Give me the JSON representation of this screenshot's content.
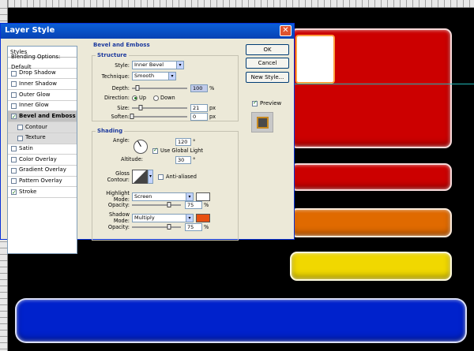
{
  "dialog": {
    "title": "Layer Style",
    "close_glyph": "✕",
    "styles_list": {
      "header": "Styles",
      "items": [
        {
          "label": "Blending Options: Default",
          "checkbox": false,
          "checked": false
        },
        {
          "label": "Drop Shadow",
          "checkbox": true,
          "checked": false
        },
        {
          "label": "Inner Shadow",
          "checkbox": true,
          "checked": false
        },
        {
          "label": "Outer Glow",
          "checkbox": true,
          "checked": false
        },
        {
          "label": "Inner Glow",
          "checkbox": true,
          "checked": false
        },
        {
          "label": "Bevel and Emboss",
          "checkbox": true,
          "checked": true,
          "selected": true
        },
        {
          "label": "Contour",
          "checkbox": true,
          "checked": false,
          "sub": true
        },
        {
          "label": "Texture",
          "checkbox": true,
          "checked": false,
          "sub": true
        },
        {
          "label": "Satin",
          "checkbox": true,
          "checked": false
        },
        {
          "label": "Color Overlay",
          "checkbox": true,
          "checked": false
        },
        {
          "label": "Gradient Overlay",
          "checkbox": true,
          "checked": false
        },
        {
          "label": "Pattern Overlay",
          "checkbox": true,
          "checked": false
        },
        {
          "label": "Stroke",
          "checkbox": true,
          "checked": true
        }
      ]
    },
    "bevel": {
      "section_title": "Bevel and Emboss",
      "structure_title": "Structure",
      "style_label": "Style:",
      "style_value": "Inner Bevel",
      "technique_label": "Technique:",
      "technique_value": "Smooth",
      "depth_label": "Depth:",
      "depth_value": "100",
      "depth_unit": "%",
      "depth_level": 0.1,
      "direction_label": "Direction:",
      "direction_up": "Up",
      "direction_down": "Down",
      "size_label": "Size:",
      "size_value": "21",
      "size_unit": "px",
      "size_level": 0.15,
      "soften_label": "Soften:",
      "soften_value": "0",
      "soften_unit": "px",
      "soften_level": 0.0
    },
    "shading": {
      "title": "Shading",
      "angle_label": "Angle:",
      "angle_value": "120",
      "degree": "°",
      "global_light_label": "Use Global Light",
      "altitude_label": "Altitude:",
      "altitude_value": "30",
      "gloss_label": "Gloss Contour:",
      "anti_aliased_label": "Anti-aliased",
      "highlight_mode_label": "Highlight Mode:",
      "highlight_mode_value": "Screen",
      "highlight_color": "#ffffff",
      "opacity_label": "Opacity:",
      "highlight_opacity": "75",
      "highlight_opacity_level": 0.75,
      "shadow_mode_label": "Shadow Mode:",
      "shadow_mode_value": "Multiply",
      "shadow_color": "#e85010",
      "shadow_opacity": "75",
      "shadow_opacity_level": 0.75,
      "percent": "%"
    },
    "buttons": {
      "ok": "OK",
      "cancel": "Cancel",
      "new_style": "New Style...",
      "preview": "Preview"
    }
  },
  "colors": {
    "red": "#cc0000",
    "orange": "#e06a00",
    "yellow": "#f0d800",
    "blue": "#0022cc",
    "guide": "#1fb6b6"
  }
}
